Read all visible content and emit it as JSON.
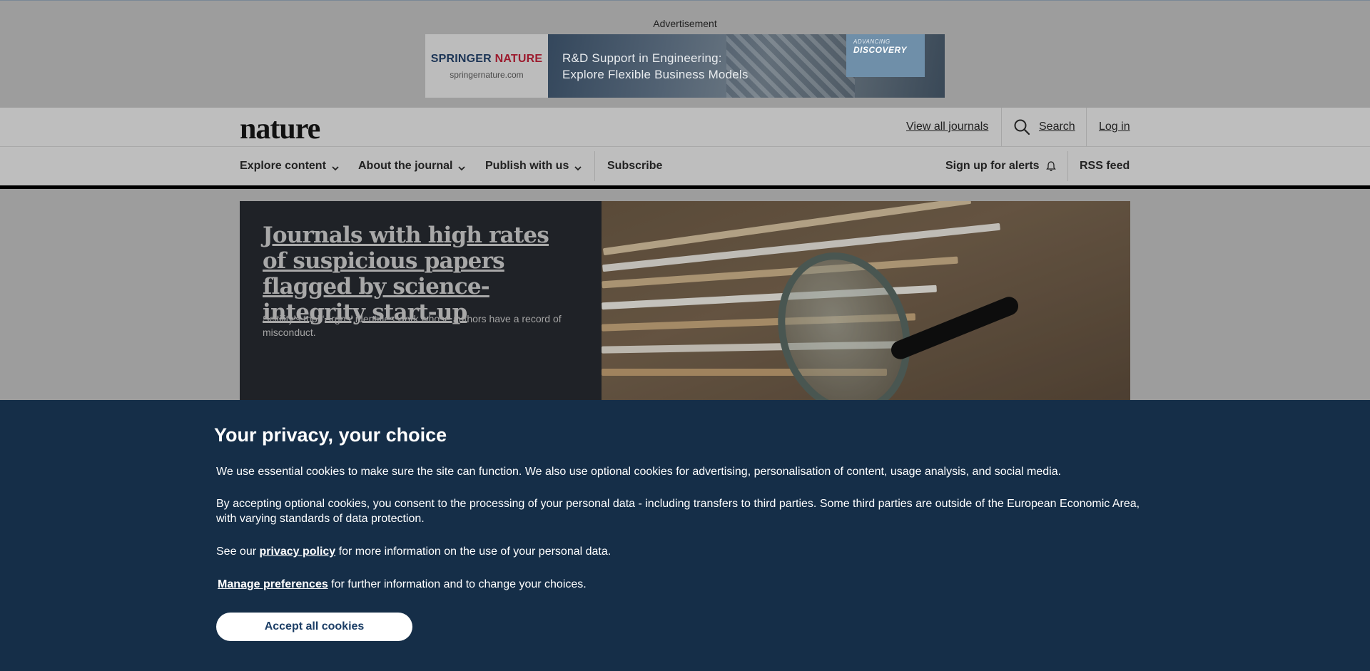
{
  "ad": {
    "label": "Advertisement",
    "brand_springer": "SPRINGER",
    "brand_nature": "NATURE",
    "brand_url": "springernature.com",
    "headline_line1": "R&D Support in Engineering:",
    "headline_line2": "Explore Flexible Business Models",
    "badge_small": "ADVANCING",
    "badge_large": "DISCOVERY"
  },
  "header": {
    "logo": "nature",
    "view_all_journals": "View all journals",
    "search_label": "Search",
    "login": "Log in"
  },
  "nav": {
    "explore": "Explore content",
    "about": "About the journal",
    "publish": "Publish with us",
    "subscribe": "Subscribe",
    "alerts": "Sign up for alerts",
    "rss": "RSS feed"
  },
  "hero": {
    "title": "Journals with high rates of suspicious papers flagged by science-integrity start-up",
    "description": "Scitility’s tool ‘Argos’ identifies work whose authors have a record of misconduct."
  },
  "cookie": {
    "title": "Your privacy, your choice",
    "p1": "We use essential cookies to make sure the site can function. We also use optional cookies for advertising, personalisation of content, usage analysis, and social media.",
    "p2": "By accepting optional cookies, you consent to the processing of your personal data - including transfers to third parties. Some third parties are outside of the European Economic Area, with varying standards of data protection.",
    "p3_prefix": "See our ",
    "privacy_link": "privacy policy",
    "p3_suffix": " for more information on the use of your personal data.",
    "manage_link": "Manage preferences",
    "p4_suffix": " for further information and to change your choices.",
    "accept_button": "Accept all cookies"
  },
  "colors": {
    "cookie_bg": "#152e48",
    "hero_bg": "#1f2227",
    "overlay_gray": "#9d9d9d",
    "button_text": "#1c3e66"
  },
  "icons": [
    "search-icon",
    "chevron-down-icon",
    "bell-icon"
  ]
}
